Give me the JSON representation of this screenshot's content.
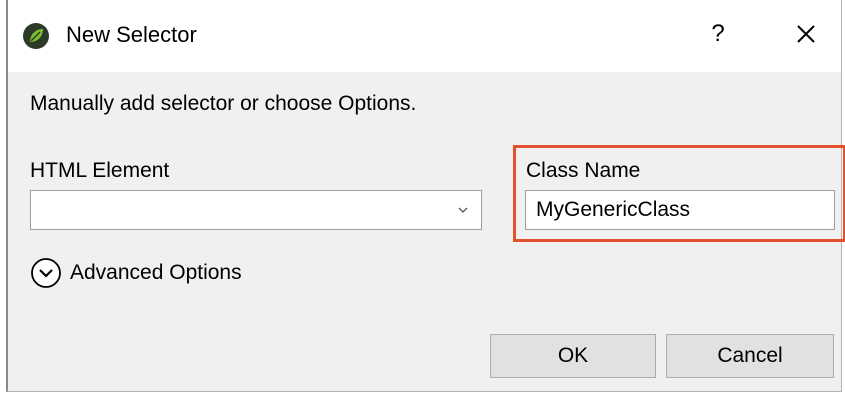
{
  "window": {
    "title": "New Selector",
    "help_label": "?",
    "app_icon": "leaf-icon",
    "close_icon": "close-icon"
  },
  "instruction": "Manually add selector or choose Options.",
  "html_element": {
    "label": "HTML Element",
    "value": "",
    "arrow_icon": "chevron-down-icon"
  },
  "class_name": {
    "label": "Class Name",
    "value": "MyGenericClass"
  },
  "advanced": {
    "label": "Advanced Options",
    "icon": "circle-chevron-down-icon"
  },
  "buttons": {
    "ok": "OK",
    "cancel": "Cancel"
  },
  "colors": {
    "highlight": "#e0522e",
    "dialog_bg": "#f0f0f0",
    "titlebar_bg": "#ffffff",
    "button_bg": "#e1e1e1",
    "icon_green": "#7cbf2e",
    "icon_dark": "#2d3a2a"
  }
}
